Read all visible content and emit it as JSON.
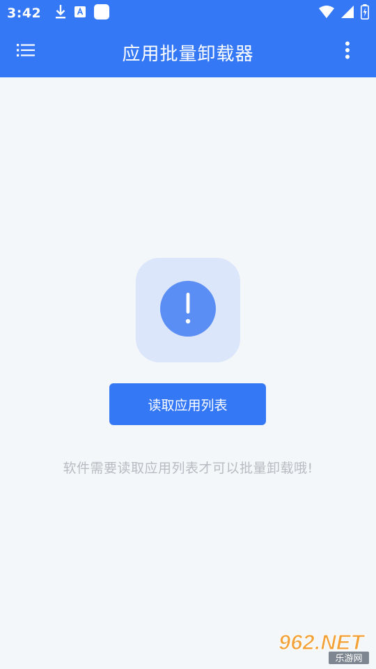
{
  "status_bar": {
    "time": "3:42"
  },
  "toolbar": {
    "title": "应用批量卸载器",
    "menu_icon": "menu-icon",
    "more_icon": "more-vert-icon"
  },
  "empty_state": {
    "icon": "alert-circle-icon",
    "button_label": "读取应用列表",
    "hint": "软件需要读取应用列表才可以批量卸载哦!"
  },
  "watermark": {
    "text": "962.NET",
    "subtext": "乐游网"
  },
  "colors": {
    "primary": "#3578f6",
    "background": "#f3f7fa",
    "icon_box": "#dbe6fb",
    "icon_circle": "#5b8ef4",
    "hint_text": "#b8bcc2"
  }
}
